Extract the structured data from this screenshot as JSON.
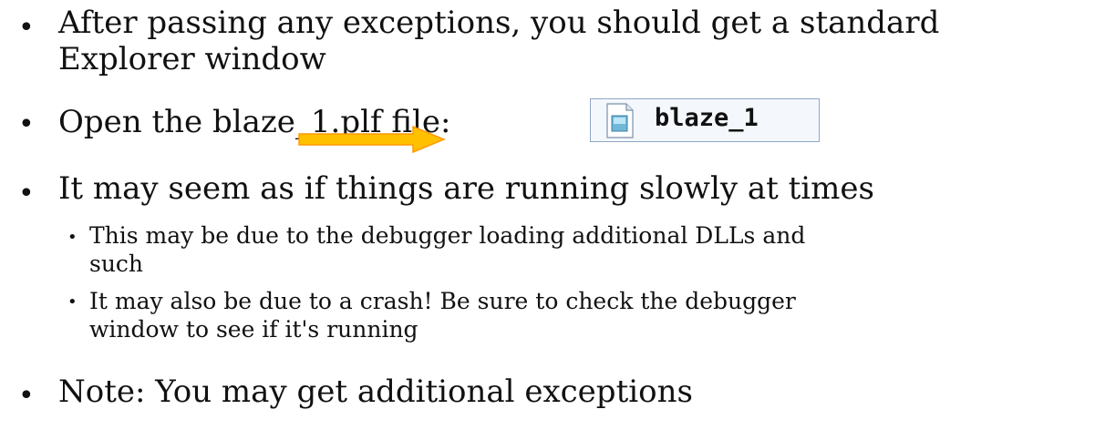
{
  "bullets": {
    "b1_line1": "After passing any exceptions, you should get a standard",
    "b1_line2": "Explorer window",
    "b2": "Open the blaze_1.plf file:",
    "b3": "It may seem as if things are running slowly at times",
    "b3_sub1_line1": "This may be due to the debugger loading additional DLLs and",
    "b3_sub1_line2": "such",
    "b3_sub2_line1": "It may also be due to a crash! Be sure to check the debugger",
    "b3_sub2_line2": "window to see if it's running",
    "b4": "Note: You may get additional exceptions"
  },
  "file_chip": {
    "label": "blaze_1",
    "icon": "document-icon"
  },
  "arrow": {
    "icon": "right-arrow-icon",
    "color": "#ffc000"
  }
}
